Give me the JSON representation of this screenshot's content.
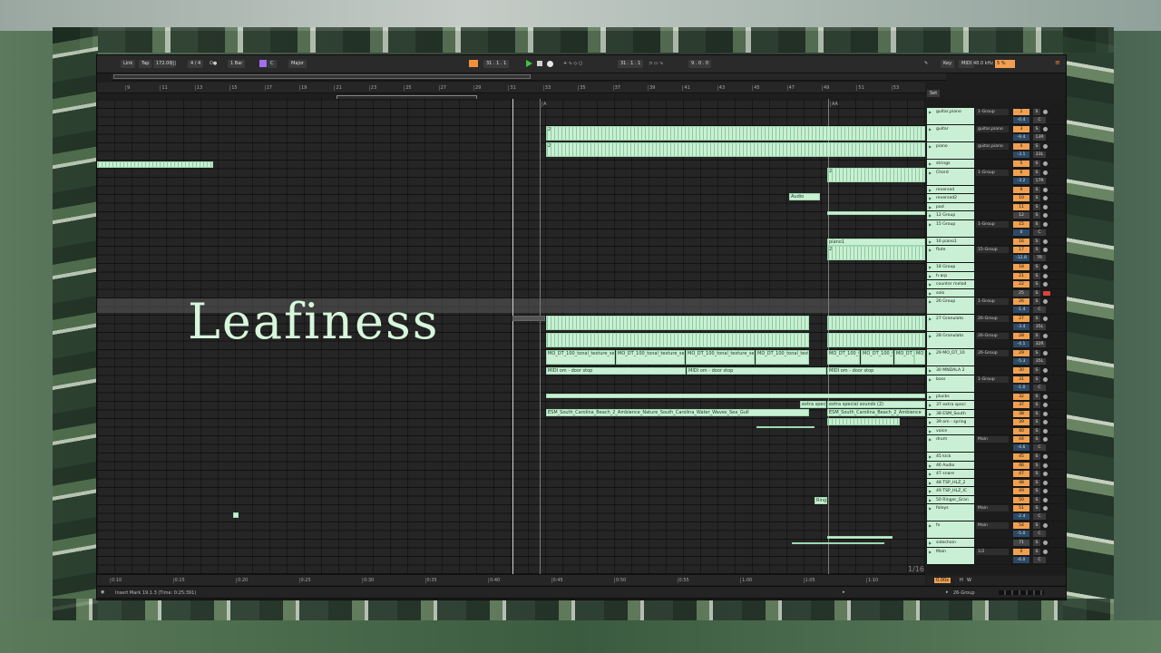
{
  "overlay_title": "Leafiness",
  "toolbar": {
    "link": "Link",
    "tap": "Tap",
    "tempo": "172.00",
    "time_sig": "4 / 4",
    "quantize": "1 Bar",
    "key": "C",
    "scale": "Major",
    "position": "31 .  1 .  1",
    "loop_start": "31 .  1 .  1",
    "loop_length": "9 .  0 .  0",
    "key_btn": "Key",
    "midi_btn": "MIDI",
    "sample_rate": "48.0 kHz",
    "cpu": "5 %"
  },
  "set_label": "Set",
  "bar_ruler": [
    "9",
    "11",
    "13",
    "15",
    "17",
    "19",
    "21",
    "23",
    "25",
    "27",
    "29",
    "31",
    "33",
    "35",
    "37",
    "39",
    "41",
    "43",
    "45",
    "47",
    "49",
    "51",
    "53"
  ],
  "time_ruler": [
    "0:10",
    "0:15",
    "0:20",
    "0:25",
    "0:30",
    "0:35",
    "0:40",
    "0:45",
    "0:50",
    "0:55",
    "1:00",
    "1:05",
    "1:10"
  ],
  "locators": {
    "a": "A",
    "aa": "AA"
  },
  "page_counter": "1/16",
  "clips": {
    "audio": "Audio",
    "piano1": "piano1",
    "num2": "2",
    "tonal1": "MO_DT_100_tonal_texture_se",
    "tonal2": "MO_DT_100_tonal_texture_se",
    "tonal3": "MO_DT_100_tonal_texture_se",
    "tonal4": "MO_DT_100_tonal_texture_se",
    "tonal5": "MO_DT_100_tonal_texture_se",
    "tonal6": "MO_DT_100_tonal_texture_se",
    "tonal7": "MO_DT_100_tonal_texture_se",
    "tonal8": "MO_DT_100",
    "midi_door_1": "MIDI om - door stop",
    "midi_door_2": "MIDI om - door stop",
    "midi_door_3": "MIDI om - door stop",
    "extra1": "extra speci",
    "extra2": "extra special sounds (2)",
    "esm1": "ESM_South_Carolina_Beach_2_Ambience_Nature_South_Carolina_Water_Waves_Sea_Gull",
    "esm2": "ESM_South_Carolina_Beach_2_Ambience",
    "ringer": "Ringe"
  },
  "tracks": [
    {
      "name": "guitar,piano",
      "route": "1-Group",
      "num": "2",
      "vol": "-0.4",
      "pan": "C"
    },
    {
      "name": "guitar",
      "route": "guitar,piano",
      "num": "3",
      "vol": "-9.4",
      "pan": "13R"
    },
    {
      "name": "piano",
      "route": "guitar,piano",
      "num": "4",
      "vol": "-3.1",
      "pan": "33L"
    },
    {
      "name": "strings",
      "route": "",
      "num": "5"
    },
    {
      "name": "Chord",
      "route": "1-Group",
      "num": "6",
      "vol": "-3.2",
      "pan": "17R"
    },
    {
      "name": "reversed",
      "route": "",
      "num": "9"
    },
    {
      "name": "reversed2",
      "route": "",
      "num": "10"
    },
    {
      "name": "pad",
      "route": "",
      "num": "11"
    },
    {
      "name": "12 Group",
      "route": "",
      "num": "12"
    },
    {
      "name": "15 Group",
      "route": "1-Group",
      "num": "15",
      "vol": "0",
      "pan": "C"
    },
    {
      "name": "16 piano1",
      "route": "",
      "num": "16"
    },
    {
      "name": "flute",
      "route": "15-Group",
      "num": "17",
      "vol": "-12.8",
      "pan": "7R"
    },
    {
      "name": "18 Group",
      "route": "",
      "num": "18"
    },
    {
      "name": "h-arp",
      "route": "",
      "num": "21"
    },
    {
      "name": "counter melod",
      "route": "",
      "num": "22"
    },
    {
      "name": "solo",
      "route": "",
      "num": "25"
    },
    {
      "name": "26 Group",
      "route": "1-Group",
      "num": "26",
      "vol": "-1.4",
      "pan": "C"
    },
    {
      "name": "27 Granulato",
      "route": "26-Group",
      "num": "27",
      "vol": "-3.4",
      "pan": "35L"
    },
    {
      "name": "28 Granulato",
      "route": "26-Group",
      "num": "28",
      "vol": "-4.1",
      "pan": "32R"
    },
    {
      "name": "29 MO_DT_10",
      "route": "26-Group",
      "num": "29",
      "vol": "-5.3",
      "pan": "35L"
    },
    {
      "name": "30 MNDALA 2",
      "route": "",
      "num": "30"
    },
    {
      "name": "bass",
      "route": "1-Group",
      "num": "31",
      "vol": "-1.0",
      "pan": "C"
    },
    {
      "name": "plucks",
      "route": "",
      "num": "32"
    },
    {
      "name": "37 extra speci",
      "route": "",
      "num": "37"
    },
    {
      "name": "38 ESM_South",
      "route": "",
      "num": "38"
    },
    {
      "name": "39 om - spring",
      "route": "",
      "num": "39"
    },
    {
      "name": "voice",
      "route": "",
      "num": "40"
    },
    {
      "name": "drum",
      "route": "Main",
      "num": "44",
      "vol": "-4.6",
      "pan": "C"
    },
    {
      "name": "45 kick",
      "route": "",
      "num": "45"
    },
    {
      "name": "46 Audio",
      "route": "",
      "num": "46"
    },
    {
      "name": "47 snare",
      "route": "",
      "num": "47"
    },
    {
      "name": "48 TSP_HLZ_2",
      "route": "",
      "num": "48"
    },
    {
      "name": "49 TSP_HLZ_IC",
      "route": "",
      "num": "49"
    },
    {
      "name": "50 Ringer_Gran",
      "route": "",
      "num": "50"
    },
    {
      "name": "foleys",
      "route": "Main",
      "num": "51",
      "vol": "-2.4",
      "pan": "C"
    },
    {
      "name": "fx",
      "route": "Main",
      "num": "54",
      "vol": "-5.0",
      "pan": "C"
    },
    {
      "name": "sidechain",
      "route": "",
      "num": "71"
    },
    {
      "name": "Main",
      "route": "1/2",
      "num": "0",
      "vol": "-6.0",
      "pan": "C"
    }
  ],
  "zoom": "0.00x",
  "h_btn": "H",
  "w_btn": "W",
  "status": "Insert Mark 19.1.3 (Time: 0:25:391)",
  "status_right": "26-Group"
}
